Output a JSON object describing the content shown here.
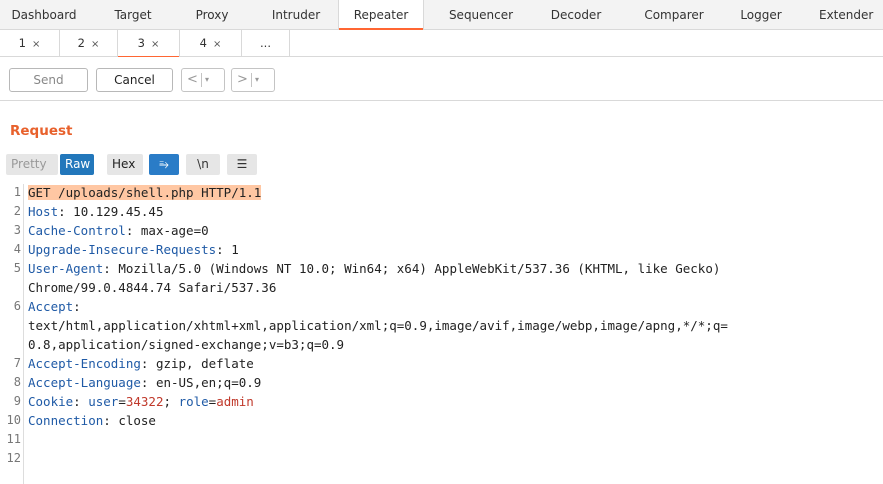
{
  "top_tabs": [
    "Dashboard",
    "Target",
    "Proxy",
    "Intruder",
    "Repeater",
    "Sequencer",
    "Decoder",
    "Comparer",
    "Logger",
    "Extender"
  ],
  "top_tab_active": "Repeater",
  "sub_tabs": [
    {
      "label": "1",
      "close": "×"
    },
    {
      "label": "2",
      "close": "×"
    },
    {
      "label": "3",
      "close": "×"
    },
    {
      "label": "4",
      "close": "×"
    },
    {
      "label": "...",
      "close": ""
    }
  ],
  "sub_tab_active": "3",
  "toolbar": {
    "send_label": "Send",
    "cancel_label": "Cancel",
    "back_glyph": "<",
    "forward_glyph": ">",
    "caret_glyph": "▾"
  },
  "request": {
    "title": "Request",
    "views": {
      "pretty": "Pretty",
      "raw": "Raw",
      "hex": "Hex",
      "newline": "\\n",
      "wrap_glyph": "⥱",
      "menu_glyph": "☰"
    },
    "lines": [
      {
        "num": "1",
        "text": "GET /uploads/shell.php HTTP/1.1"
      },
      {
        "num": "2",
        "key": "Host",
        "value": " 10.129.45.45"
      },
      {
        "num": "3",
        "key": "Cache-Control",
        "value": " max-age=0"
      },
      {
        "num": "4",
        "key": "Upgrade-Insecure-Requests",
        "value": " 1"
      },
      {
        "num": "5",
        "key": "User-Agent",
        "value": " Mozilla/5.0 (Windows NT 10.0; Win64; x64) AppleWebKit/537.36 (KHTML, like Gecko)"
      },
      {
        "num": "",
        "text": "Chrome/99.0.4844.74 Safari/537.36"
      },
      {
        "num": "6",
        "key": "Accept",
        "value": ""
      },
      {
        "num": "",
        "text": "text/html,application/xhtml+xml,application/xml;q=0.9,image/avif,image/webp,image/apng,*/*;q="
      },
      {
        "num": "",
        "text": "0.8,application/signed-exchange;v=b3;q=0.9"
      },
      {
        "num": "7",
        "key": "Accept-Encoding",
        "value": " gzip, deflate"
      },
      {
        "num": "8",
        "key": "Accept-Language",
        "value": " en-US,en;q=0.9"
      },
      {
        "num": "9",
        "key": "Cookie",
        "cookie_user_k": "user",
        "cookie_user_v": "34322",
        "cookie_role_k": "role",
        "cookie_role_v": "admin"
      },
      {
        "num": "10",
        "key": "Connection",
        "value": " close"
      },
      {
        "num": "11",
        "text": ""
      },
      {
        "num": "12",
        "text": ""
      }
    ]
  },
  "colors": {
    "accent": "#ff6633",
    "title": "#e8612c",
    "raw_active": "#2277bb",
    "header_key": "#1f5aa6",
    "cookie_value": "#c0392b",
    "highlight": "#ffc7a3"
  }
}
